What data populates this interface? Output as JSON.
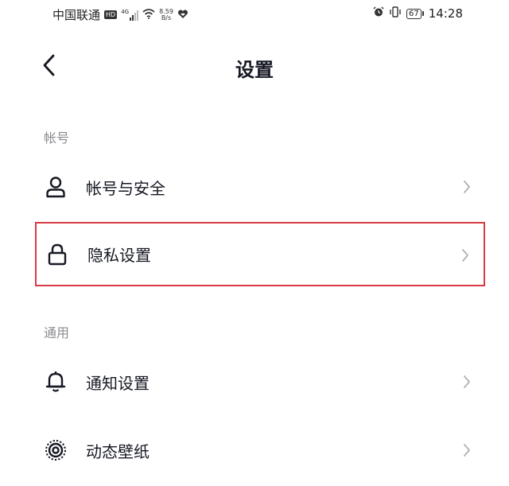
{
  "status_bar": {
    "carrier": "中国联通",
    "hd_badge": "HD",
    "signal_label": "4G",
    "net_speed_value": "8.59",
    "net_speed_unit": "B/s",
    "battery": "67",
    "time": "14:28"
  },
  "header": {
    "title": "设置"
  },
  "sections": [
    {
      "title": "帐号",
      "items": [
        {
          "label": "帐号与安全",
          "icon": "person-icon"
        },
        {
          "label": "隐私设置",
          "icon": "lock-icon",
          "highlighted": true
        }
      ]
    },
    {
      "title": "通用",
      "items": [
        {
          "label": "通知设置",
          "icon": "bell-icon"
        },
        {
          "label": "动态壁纸",
          "icon": "live-wallpaper-icon"
        }
      ]
    }
  ],
  "colors": {
    "highlight_border": "#d93a45",
    "section_header": "#8a8b91",
    "text_primary": "#161823",
    "chevron": "#b0b1b5"
  }
}
